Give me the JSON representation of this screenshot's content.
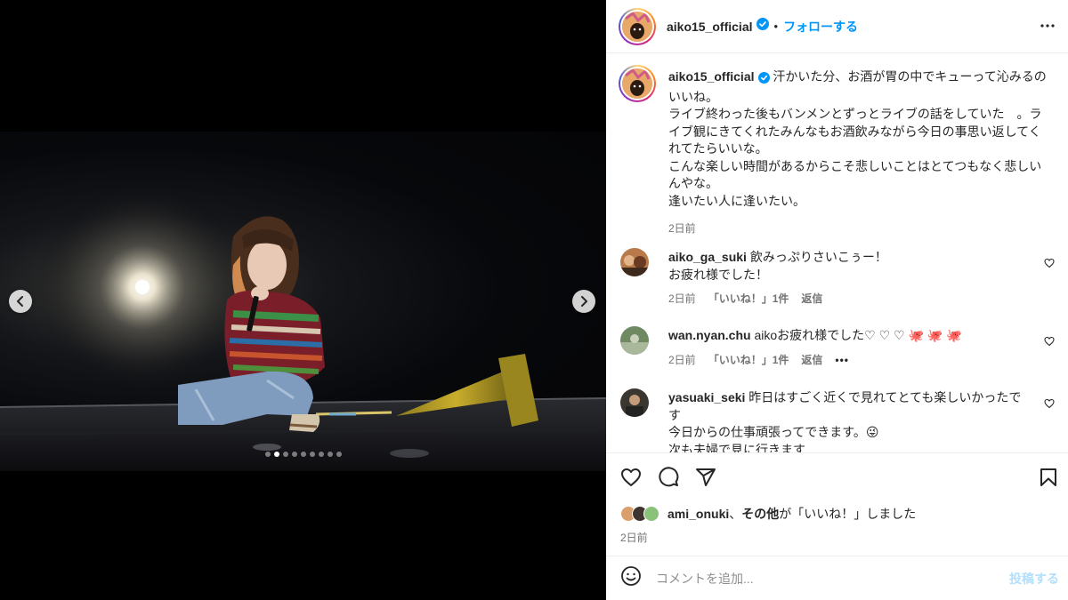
{
  "post": {
    "username": "aiko15_official",
    "follow_label": "フォローする",
    "separator": "•",
    "caption_username": "aiko15_official",
    "caption_text": "汗かいた分、お酒が胃の中でキューって沁みるのいいね。\nライブ終わった後もバンメンとずっとライブの話をしていた　。ライブ観にきてくれたみんなもお酒飲みながら今日の事思い返してくれてたらいいな。\nこんな楽しい時間があるからこそ悲しいことはとてつもなく悲しいんやな。\n逢いたい人に逢いたい。",
    "caption_time": "2日前",
    "carousel_count": 9,
    "carousel_active": 1
  },
  "comments": [
    {
      "username": "aiko_ga_suki",
      "text": "飲みっぷりさいこぅー！\nお疲れ様でした！",
      "time": "2日前",
      "likes": "「いいね！」1件",
      "reply": "返信",
      "more": ""
    },
    {
      "username": "wan.nyan.chu",
      "text": "aikoお疲れ様でした♡ ♡ ♡ 🐙 🐙 🐙",
      "time": "2日前",
      "likes": "「いいね！」1件",
      "reply": "返信",
      "more": "•••"
    },
    {
      "username": "yasuaki_seki",
      "text": "昨日はすごく近くで見れてとても楽しいかったです\n今日からの仕事頑張ってできます。😜\n次も夫婦で見に行きます",
      "time": "",
      "likes": "",
      "reply": "",
      "more": ""
    }
  ],
  "likes": {
    "user": "ami_onuki",
    "sep": "、",
    "others": "その他",
    "ga": "が",
    "suffix": "「いいね！」しました"
  },
  "post_time": "2日前",
  "comment_box": {
    "placeholder": "コメントを追加...",
    "post_label": "投稿する"
  },
  "colors": {
    "link": "#0095f6",
    "muted": "#737373",
    "post_disabled": "#b2dffc"
  },
  "icons": [
    "chevron-left-icon",
    "chevron-right-icon",
    "verified-icon",
    "more-icon",
    "heart-icon",
    "comment-icon",
    "share-icon",
    "bookmark-icon",
    "emoji-icon"
  ]
}
